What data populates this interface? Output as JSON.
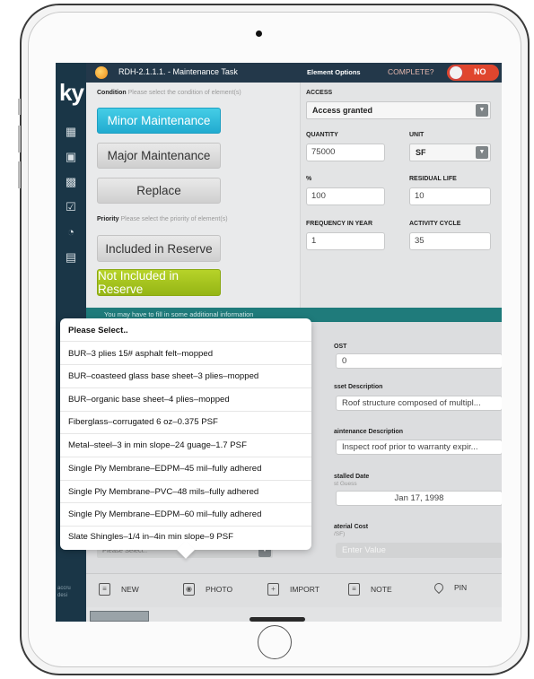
{
  "topbar": {
    "task_title": "RDH-2.1.1.1. - Maintenance Task",
    "element_options_label": "Element Options",
    "complete_label": "COMPLETE?",
    "complete_toggle": "NO"
  },
  "sidebar": {
    "logo": "ky",
    "footer_text_1": "accru",
    "footer_text_2": "desi"
  },
  "condition": {
    "label": "Condition",
    "hint": "Please select the condition of element(s)",
    "options": [
      "Minor Maintenance",
      "Major Maintenance",
      "Replace"
    ],
    "selected": "Minor Maintenance"
  },
  "priority": {
    "label": "Priority",
    "hint": "Please select the priority of element(s)",
    "options": [
      "Included in Reserve",
      "Not Included in Reserve"
    ],
    "selected": "Not Included in Reserve"
  },
  "access": {
    "label": "ACCESS",
    "value": "Access granted"
  },
  "quantity": {
    "label": "QUANTITY",
    "value": "75000"
  },
  "unit": {
    "label": "UNIT",
    "value": "SF"
  },
  "percent": {
    "label": "%",
    "value": "100"
  },
  "residual_life": {
    "label": "RESIDUAL LIFE",
    "value": "10"
  },
  "frequency": {
    "label": "FREQUENCY IN YEAR",
    "value": "1"
  },
  "activity_cycle": {
    "label": "ACTIVITY CYCLE",
    "value": "35"
  },
  "banner": {
    "text": "You may have to fill in some additional information"
  },
  "details": {
    "cost_label": "OST",
    "cost_value": "0",
    "asset_desc_label": "sset Description",
    "asset_desc_value": "Roof structure composed of multipl...",
    "maint_desc_label": "aintenance Description",
    "maint_desc_value": "Inspect roof prior to warranty expir...",
    "installed_label": "stalled Date",
    "installed_sub": "st Guess",
    "installed_value": "Jan 17, 1998",
    "material_label": "aterial Cost",
    "material_sub": "/SF)",
    "material_placeholder": "Enter Value",
    "below_select_placeholder": "Please Select.."
  },
  "dropdown": {
    "items": [
      "Please Select..",
      "BUR–3 plies 15# asphalt felt–mopped",
      "BUR–coasteed glass base sheet–3 plies–mopped",
      "BUR–organic base sheet–4 plies–mopped",
      "Fiberglass–corrugated 6 oz–0.375 PSF",
      "Metal–steel–3 in min slope–24 guage–1.7 PSF",
      "Single Ply Membrane–EDPM–45 mil–fully adhered",
      "Single Ply Membrane–PVC–48 mils–fully adhered",
      "Single Ply Membrane–EDPM–60 mil–fully adhered",
      "Slate Shingles–1/4 in–4in min slope–9 PSF"
    ]
  },
  "toolbar": {
    "new_label": "NEW",
    "photo_label": "PHOTO",
    "import_label": "IMPORT",
    "note_label": "NOTE",
    "pin_label": "PIN"
  },
  "colors": {
    "accent_blue": "#21abd0",
    "accent_green": "#95b515",
    "toggle_red": "#e0462e",
    "nav_dark": "#1a3647",
    "teal": "#1f7b7b"
  }
}
